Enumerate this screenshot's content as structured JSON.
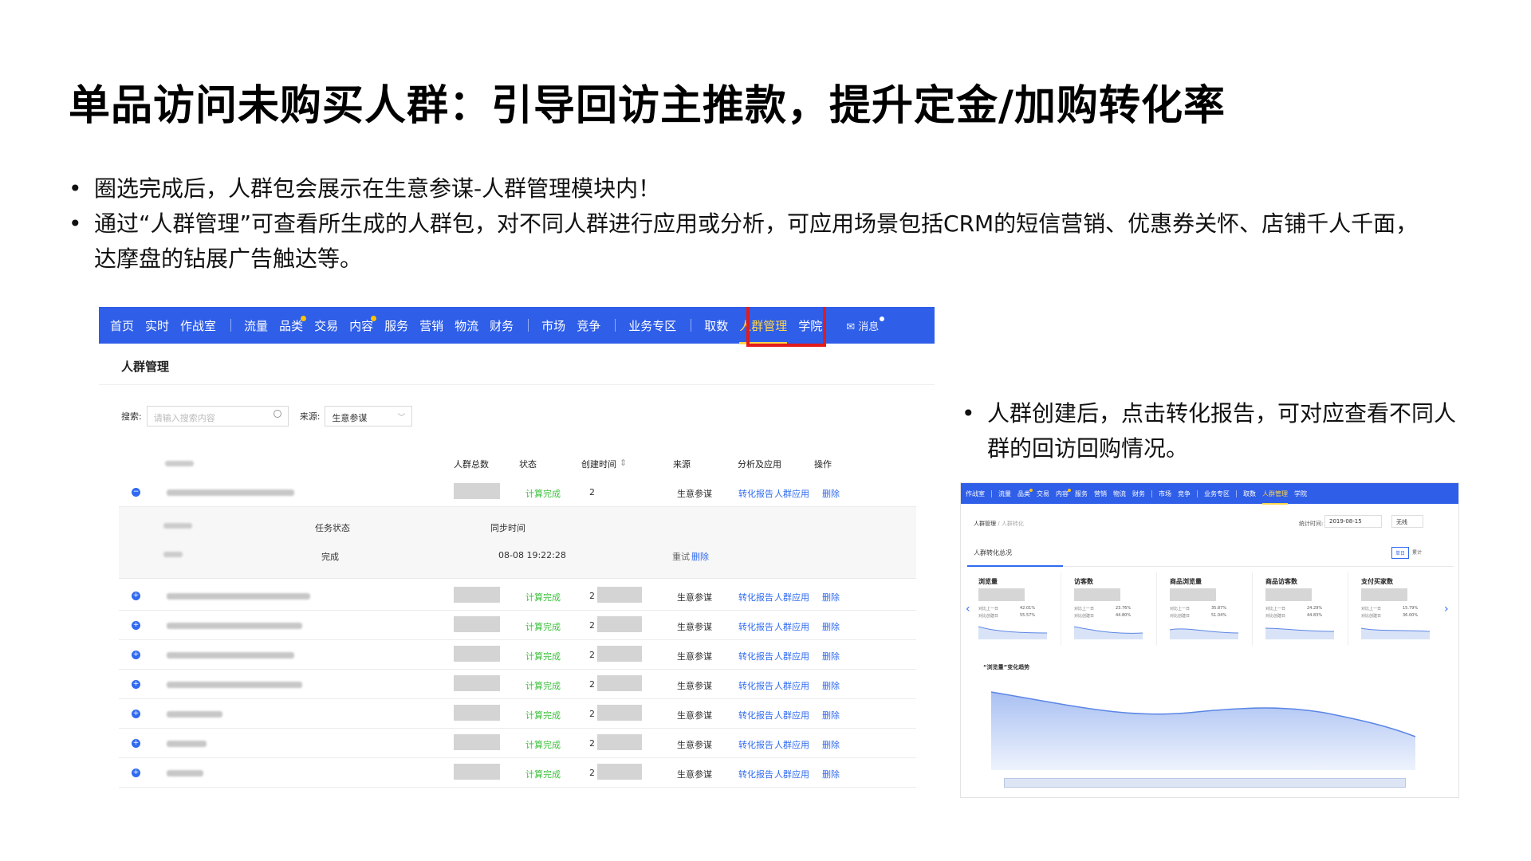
{
  "title": "单品访问未购买人群：引导回访主推款，提升定金/加购转化率",
  "bullets": [
    "圈选完成后，人群包会展示在生意参谋-人群管理模块内！",
    "通过“人群管理”可查看所生成的人群包，对不同人群进行应用或分析，可应用场景包括CRM的短信营销、优惠券关怀、店铺千人千面，达摩盘的钻展广告触达等。"
  ],
  "right_bullet": "人群创建后，点击转化报告，可对应查看不同人群的回访回购情况。",
  "colors": {
    "nav": "#2f5ee8",
    "active": "#ffd54a",
    "link": "#2f6af0",
    "ok": "#3cbf3c",
    "highlight": "#e31b1b"
  },
  "shot1": {
    "nav_left": [
      "首页",
      "实时",
      "作战室"
    ],
    "nav_group2": [
      "流量",
      "品类",
      "交易",
      "内容",
      "服务",
      "营销",
      "物流",
      "财务"
    ],
    "nav_group3": [
      "市场",
      "竞争"
    ],
    "nav_group4": [
      "业务专区"
    ],
    "nav_group5": [
      "取数",
      "人群管理",
      "学院"
    ],
    "nav_msg": "消息",
    "page_title": "人群管理",
    "search_label": "搜索:",
    "search_placeholder": "请输入搜索内容",
    "source_label": "来源:",
    "source_value": "生意参谋",
    "headers": {
      "total": "人群总数",
      "status": "状态",
      "created": "创建时间",
      "source": "来源",
      "analysis": "分析及应用",
      "ops": "操作"
    },
    "sub": {
      "h_status": "任务状态",
      "h_sync": "同步时间",
      "v_status": "完成",
      "v_sync": "08-08 19:22:28",
      "retry": "重试",
      "delete": "删除"
    },
    "rows": [
      {
        "status": "计算完成",
        "c2": "2",
        "source": "生意参谋",
        "l1": "转化报告",
        "l2": "人群应用",
        "del": "删除"
      },
      {
        "status": "计算完成",
        "c2": "2",
        "source": "生意参谋",
        "l1": "转化报告",
        "l2": "人群应用",
        "del": "删除"
      },
      {
        "status": "计算完成",
        "c2": "2",
        "source": "生意参谋",
        "l1": "转化报告",
        "l2": "人群应用",
        "del": "删除"
      },
      {
        "status": "计算完成",
        "c2": "2",
        "source": "生意参谋",
        "l1": "转化报告",
        "l2": "人群应用",
        "del": "删除"
      },
      {
        "status": "计算完成",
        "c2": "2",
        "source": "生意参谋",
        "l1": "转化报告",
        "l2": "人群应用",
        "del": "删除"
      },
      {
        "status": "计算完成",
        "c2": "2",
        "source": "生意参谋",
        "l1": "转化报告",
        "l2": "人群应用",
        "del": "删除"
      },
      {
        "status": "计算完成",
        "c2": "2",
        "source": "生意参谋",
        "l1": "转化报告",
        "l2": "人群应用",
        "del": "删除"
      },
      {
        "status": "计算完成",
        "c2": "2",
        "source": "生意参谋",
        "l1": "转化报告",
        "l2": "人群应用",
        "del": "删除"
      }
    ]
  },
  "shot2": {
    "nav": [
      "作战室",
      "流量",
      "品类",
      "交易",
      "内容",
      "服务",
      "营销",
      "物流",
      "财务",
      "市场",
      "竞争",
      "业务专区",
      "取数",
      "人群管理",
      "学院"
    ],
    "crumb1": "人群管理",
    "crumb_sep": "/",
    "crumb2": "人群转化",
    "stat_label": "统计时间:",
    "date": "2019-08-15",
    "section": "人群转化总况",
    "tag1": "单日",
    "tag2": "累计",
    "wx": "无线",
    "cards": [
      {
        "title": "浏览量",
        "l1": "对比上一日",
        "v1": "42.01%",
        "l2": "对比创建日",
        "v2": "55.57%"
      },
      {
        "title": "访客数",
        "l1": "对比上一日",
        "v1": "23.76%",
        "l2": "对比创建日",
        "v2": "44.80%"
      },
      {
        "title": "商品浏览量",
        "l1": "对比上一日",
        "v1": "35.87%",
        "l2": "对比创建日",
        "v2": "51.04%"
      },
      {
        "title": "商品访客数",
        "l1": "对比上一日",
        "v1": "24.29%",
        "l2": "对比创建日",
        "v2": "44.83%"
      },
      {
        "title": "支付买家数",
        "l1": "对比上一日",
        "v1": "15.79%",
        "l2": "对比创建日",
        "v2": "36.00%"
      }
    ],
    "trend_title": "“浏览量”变化趋势"
  }
}
